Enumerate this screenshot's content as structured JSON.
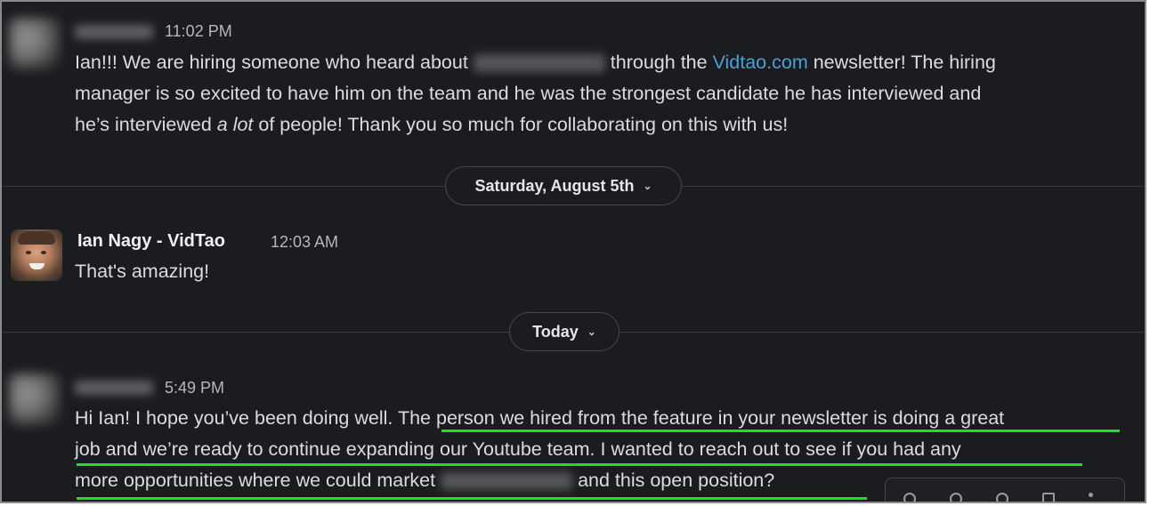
{
  "messages": [
    {
      "time": "11:02 PM",
      "line1_a": "Ian!!! We are hiring someone who heard about",
      "line1_b": "through the",
      "line1_link": "Vidtao.com",
      "line1_c": "newsletter! The hiring",
      "line2": "manager is so excited to have him on the team and he was the strongest candidate he has interviewed and",
      "line3_a": "he’s interviewed",
      "line3_em": "a lot",
      "line3_b": "of people! Thank you so much for collaborating on this with us!"
    },
    {
      "author": "Ian Nagy - VidTao",
      "time": "12:03 AM",
      "text": "That's amazing!"
    },
    {
      "time": "5:49 PM",
      "line1": "Hi Ian! I hope you’ve been doing well. The person we hired from the feature in your newsletter is doing a great",
      "line2": "job and we’re ready to continue expanding our Youtube team. I wanted to reach out to see if you had any",
      "line3_a": "more opportunities where we could market",
      "line3_b": "and this open position?"
    }
  ],
  "dividers": {
    "first": "Saturday, August 5th",
    "second": "Today"
  },
  "colors": {
    "background": "#1b1c20",
    "link": "#4a9fd6",
    "highlight_underline": "#1fe01f"
  },
  "icons": [
    "chevron-down-icon",
    "message-actions-toolbar"
  ]
}
